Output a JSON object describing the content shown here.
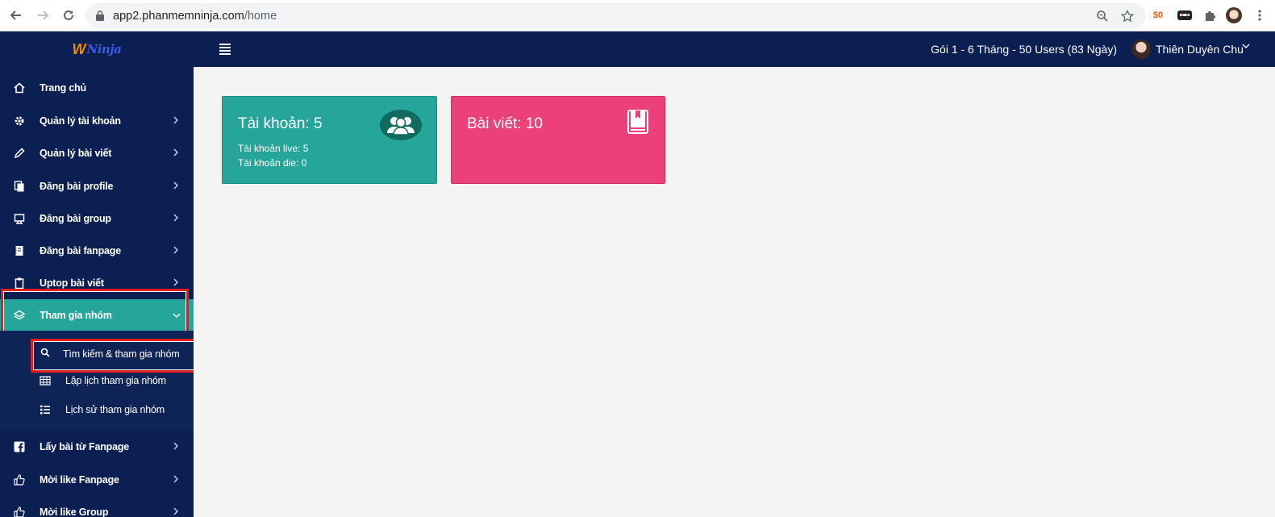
{
  "browser": {
    "url_host": "app2.phanmemninja.com",
    "url_path": "/home",
    "extension_badge": "$0"
  },
  "header": {
    "logo_text": "Ninja",
    "plan": "Gói 1 - 6 Tháng - 50 Users (83 Ngày)",
    "user_name": "Thiên Duyên Chu"
  },
  "sidebar": {
    "items": [
      {
        "label": "Trang chủ",
        "icon": "home-icon"
      },
      {
        "label": "Quản lý tài khoản",
        "icon": "gear-icon"
      },
      {
        "label": "Quản lý bài viết",
        "icon": "pencil-icon"
      },
      {
        "label": "Đăng bài profile",
        "icon": "copy-icon"
      },
      {
        "label": "Đăng bài group",
        "icon": "group-post-icon"
      },
      {
        "label": "Đăng bài fanpage",
        "icon": "notebook-icon"
      },
      {
        "label": "Uptop bài viết",
        "icon": "clipboard-icon"
      },
      {
        "label": "Tham gia nhóm",
        "icon": "layers-icon"
      },
      {
        "label": "Lấy bài từ Fanpage",
        "icon": "facebook-icon"
      },
      {
        "label": "Mời like Fanpage",
        "icon": "thumbs-up-icon"
      },
      {
        "label": "Mời like Group",
        "icon": "thumbs-up-icon"
      }
    ],
    "submenu": [
      {
        "label": "Tìm kiếm & tham gia nhóm",
        "icon": "search-icon"
      },
      {
        "label": "Lập lịch tham gia nhóm",
        "icon": "calendar-grid-icon"
      },
      {
        "label": "Lịch sử tham gia nhóm",
        "icon": "list-icon"
      }
    ]
  },
  "cards": {
    "accounts": {
      "title": "Tài khoản: 5",
      "live": "Tài khoản live: 5",
      "die": "Tài khoản die: 0",
      "color": "#26a69a"
    },
    "posts": {
      "title": "Bài viết: 10",
      "color": "#ec407a"
    }
  },
  "colors": {
    "nav_bg": "#0b1f52",
    "active": "#26a69a",
    "highlight": "#e01e1e"
  }
}
